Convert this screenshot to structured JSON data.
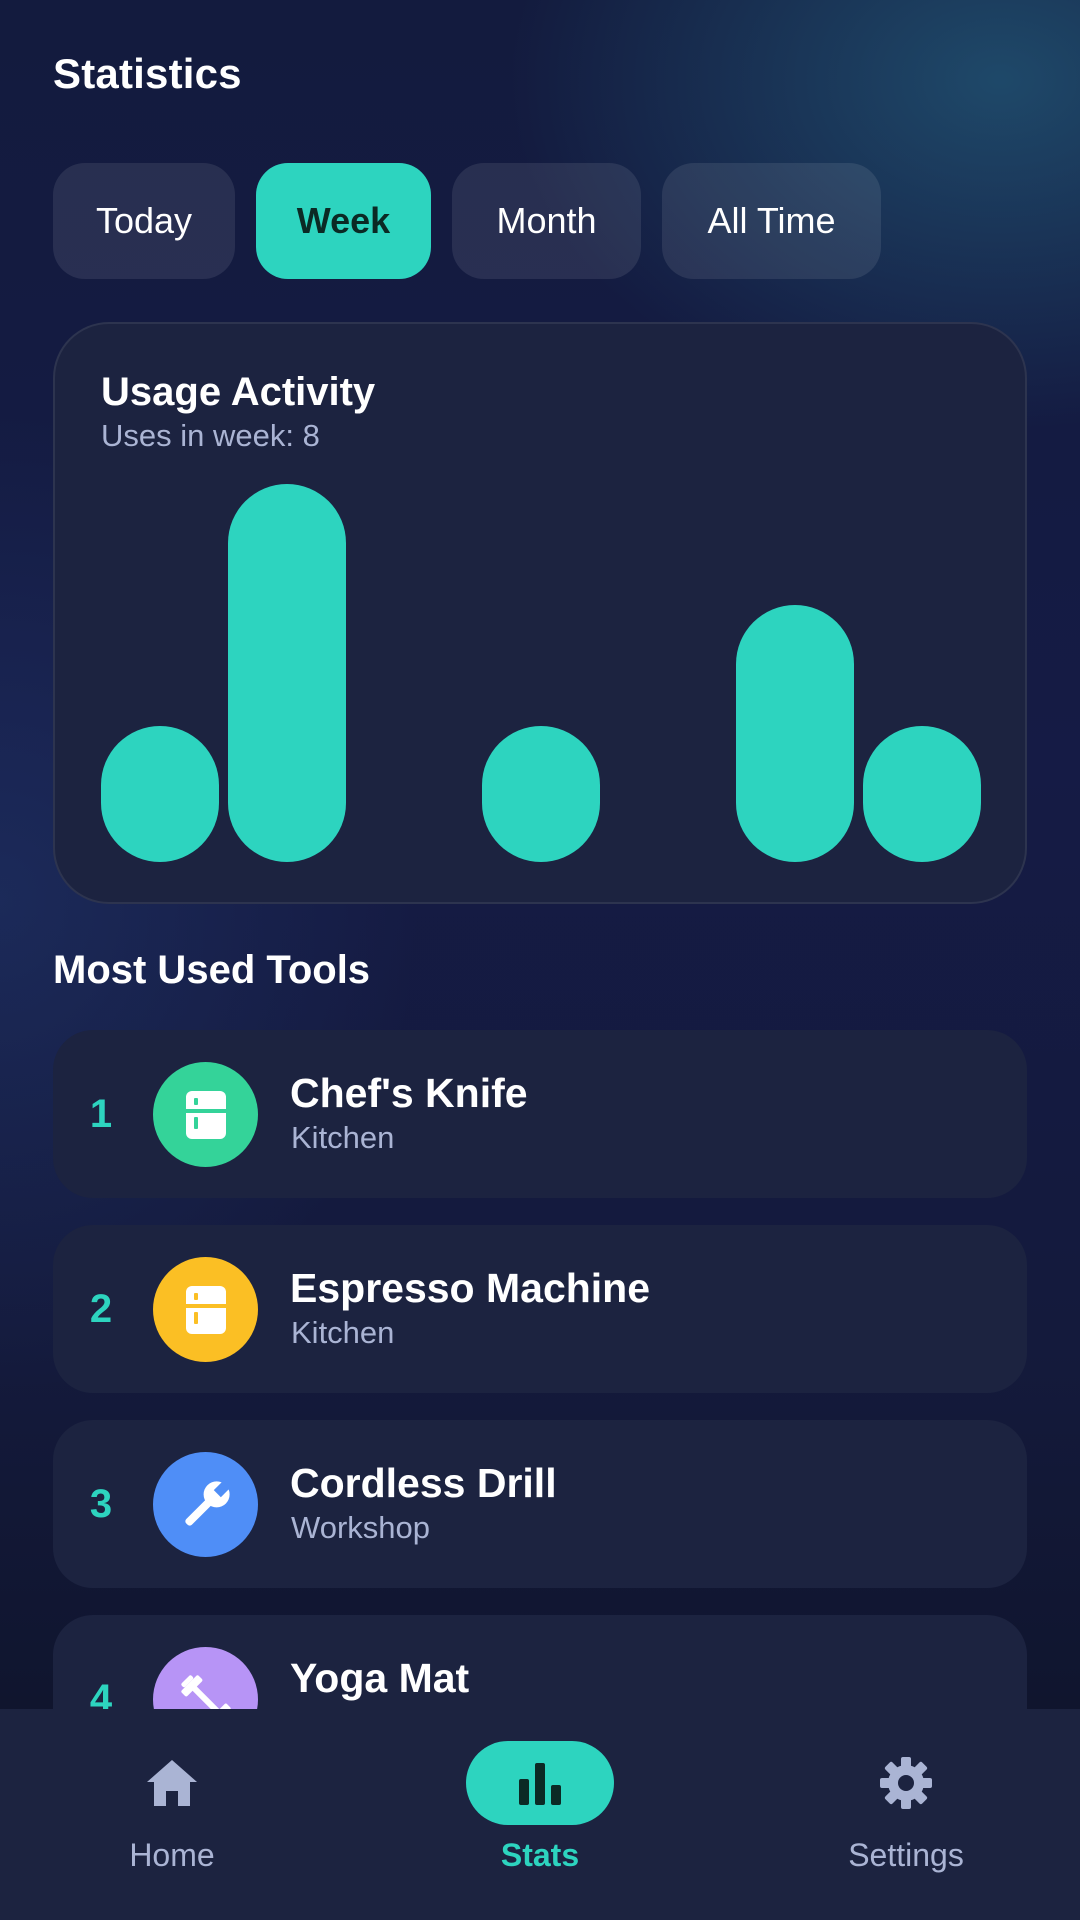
{
  "page_title": "Statistics",
  "tabs": [
    {
      "label": "Today",
      "active": false
    },
    {
      "label": "Week",
      "active": true
    },
    {
      "label": "Month",
      "active": false
    },
    {
      "label": "All Time",
      "active": false
    }
  ],
  "usage_card": {
    "title": "Usage Activity",
    "subtitle": "Uses in week: 8"
  },
  "chart_data": {
    "type": "bar",
    "categories": [
      "",
      "",
      "",
      "",
      "",
      "",
      ""
    ],
    "values": [
      1,
      3,
      0,
      1,
      0,
      2,
      1
    ],
    "ylim": [
      0,
      3
    ],
    "grid": false,
    "color": "#2dd4bf"
  },
  "section_title": "Most Used Tools",
  "tools": [
    {
      "rank": "1",
      "name": "Chef's Knife",
      "category": "Kitchen",
      "icon": "fridge-icon",
      "color": "#34d399"
    },
    {
      "rank": "2",
      "name": "Espresso Machine",
      "category": "Kitchen",
      "icon": "fridge-icon",
      "color": "#fbbf24"
    },
    {
      "rank": "3",
      "name": "Cordless Drill",
      "category": "Workshop",
      "icon": "wrench-icon",
      "color": "#4f8ef7"
    },
    {
      "rank": "4",
      "name": "Yoga Mat",
      "category": "",
      "icon": "dumbbell-icon",
      "color": "#b794f6"
    }
  ],
  "nav": {
    "items": [
      {
        "label": "Home",
        "icon": "home-icon",
        "active": false
      },
      {
        "label": "Stats",
        "icon": "bar-chart-icon",
        "active": true
      },
      {
        "label": "Settings",
        "icon": "gear-icon",
        "active": false
      }
    ]
  },
  "colors": {
    "accent": "#2dd4bf",
    "card": "#1c2340",
    "muted_text": "#aab4d4"
  }
}
